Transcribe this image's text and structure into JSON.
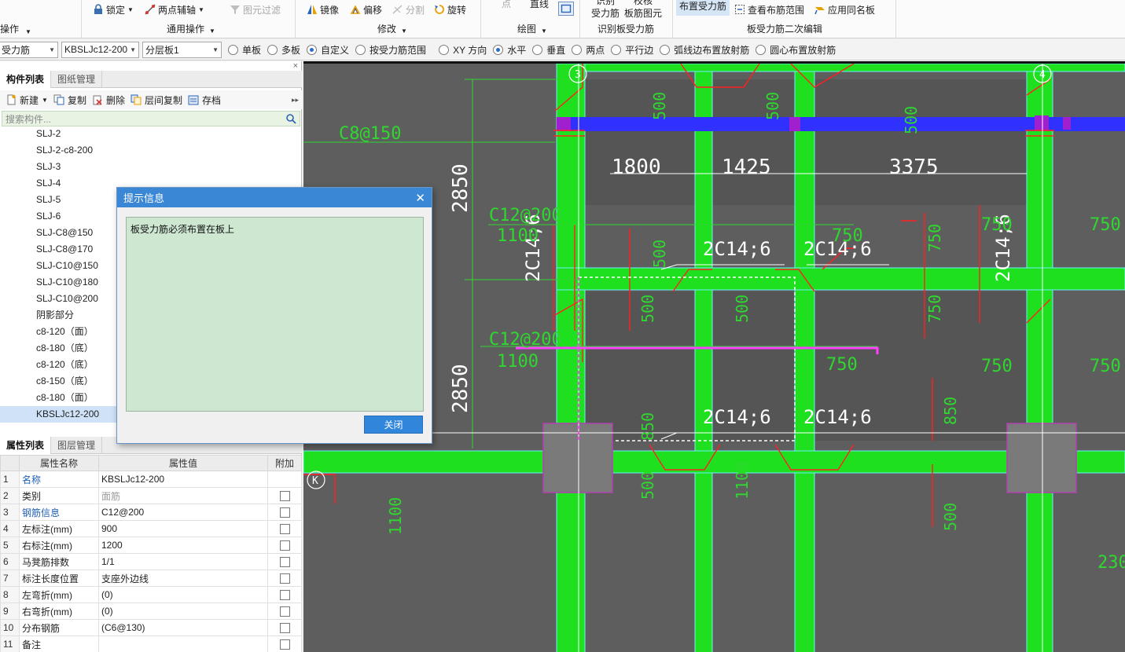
{
  "ribbon": {
    "partial_op_label": "操作",
    "general": {
      "lock": "锁定",
      "two_point_axis": "两点辅轴",
      "element_filter": "图元过滤",
      "label": "通用操作"
    },
    "modify": {
      "mirror": "镜像",
      "offset": "偏移",
      "split": "分割",
      "rotate": "旋转",
      "label": "修改"
    },
    "draw": {
      "point": "点",
      "line": "直线",
      "label": "绘图"
    },
    "identify": {
      "identify_top": "识别",
      "identify_bottom": "受力筋",
      "check_top": "校核",
      "check_bottom": "板筋图元",
      "label": "识别板受力筋"
    },
    "edit2": {
      "place": "布置受力筋",
      "view_range": "查看布筋范围",
      "apply_same": "应用同名板",
      "label": "板受力筋二次编辑"
    }
  },
  "optionbar": {
    "combo1": "受力筋",
    "combo2": "KBSLJc12-200",
    "combo3": "分层板1",
    "radios": [
      {
        "label": "单板",
        "checked": false
      },
      {
        "label": "多板",
        "checked": false
      },
      {
        "label": "自定义",
        "checked": true
      },
      {
        "label": "按受力筋范围",
        "checked": false
      },
      {
        "label": "XY 方向",
        "checked": false
      },
      {
        "label": "水平",
        "checked": true
      },
      {
        "label": "垂直",
        "checked": false
      },
      {
        "label": "两点",
        "checked": false
      },
      {
        "label": "平行边",
        "checked": false
      },
      {
        "label": "弧线边布置放射筋",
        "checked": false
      },
      {
        "label": "圆心布置放射筋",
        "checked": false
      }
    ]
  },
  "left_panel": {
    "tabs": [
      "构件列表",
      "图纸管理"
    ],
    "toolbar": {
      "new": "新建",
      "copy": "复制",
      "delete": "删除",
      "floor_copy": "层间复制",
      "archive": "存档"
    },
    "search_placeholder": "搜索构件...",
    "tree_items": [
      "SLJ-2",
      "SLJ-2-c8-200",
      "SLJ-3",
      "SLJ-4",
      "SLJ-5",
      "SLJ-6",
      "SLJ-C8@150",
      "SLJ-C8@170",
      "SLJ-C10@150",
      "SLJ-C10@180",
      "SLJ-C10@200",
      "阴影部分",
      "c8-120（面）",
      "c8-180（底）",
      "c8-120（底）",
      "c8-150（底）",
      "c8-180（面）",
      "KBSLJc12-200"
    ],
    "selected_item": "KBSLJc12-200"
  },
  "props_panel": {
    "tabs": [
      "属性列表",
      "图层管理"
    ],
    "headers": [
      "属性名称",
      "属性值",
      "附加"
    ],
    "rows": [
      {
        "idx": "1",
        "name": "名称",
        "value": "KBSLJc12-200",
        "blue": true,
        "gray": false,
        "check": false
      },
      {
        "idx": "2",
        "name": "类别",
        "value": "面筋",
        "blue": false,
        "gray": true,
        "check": true
      },
      {
        "idx": "3",
        "name": "钢筋信息",
        "value": "C12@200",
        "blue": true,
        "gray": false,
        "check": true
      },
      {
        "idx": "4",
        "name": "左标注(mm)",
        "value": "900",
        "blue": false,
        "gray": false,
        "check": true
      },
      {
        "idx": "5",
        "name": "右标注(mm)",
        "value": "1200",
        "blue": false,
        "gray": false,
        "check": true
      },
      {
        "idx": "6",
        "name": "马凳筋排数",
        "value": "1/1",
        "blue": false,
        "gray": false,
        "check": true
      },
      {
        "idx": "7",
        "name": "标注长度位置",
        "value": "支座外边线",
        "blue": false,
        "gray": false,
        "check": true
      },
      {
        "idx": "8",
        "name": "左弯折(mm)",
        "value": "(0)",
        "blue": false,
        "gray": false,
        "check": true
      },
      {
        "idx": "9",
        "name": "右弯折(mm)",
        "value": "(0)",
        "blue": false,
        "gray": false,
        "check": true
      },
      {
        "idx": "10",
        "name": "分布钢筋",
        "value": "(C6@130)",
        "blue": false,
        "gray": false,
        "check": true
      },
      {
        "idx": "11",
        "name": "备注",
        "value": "",
        "blue": false,
        "gray": false,
        "check": true
      }
    ]
  },
  "dialog": {
    "title": "提示信息",
    "message": "板受力筋必须布置在板上",
    "close_label": "关闭"
  },
  "canvas": {
    "axis_labels": [
      "3",
      "4",
      "K"
    ],
    "dims_white": [
      "1800",
      "1425",
      "3375",
      "2850",
      "2850"
    ],
    "rebar_labels": [
      "2C14;6",
      "2C14;6",
      "2C14;6",
      "2C14;6",
      "2C14;6",
      "2C14;6"
    ],
    "green_texts": [
      "C8@150",
      "C12@200",
      "1100",
      "C12@200",
      "1100",
      "500",
      "500",
      "750",
      "750",
      "750",
      "750",
      "750",
      "750",
      "750",
      "750",
      "500",
      "500",
      "500",
      "500",
      "850",
      "850",
      "500",
      "500",
      "1100",
      "230"
    ]
  }
}
